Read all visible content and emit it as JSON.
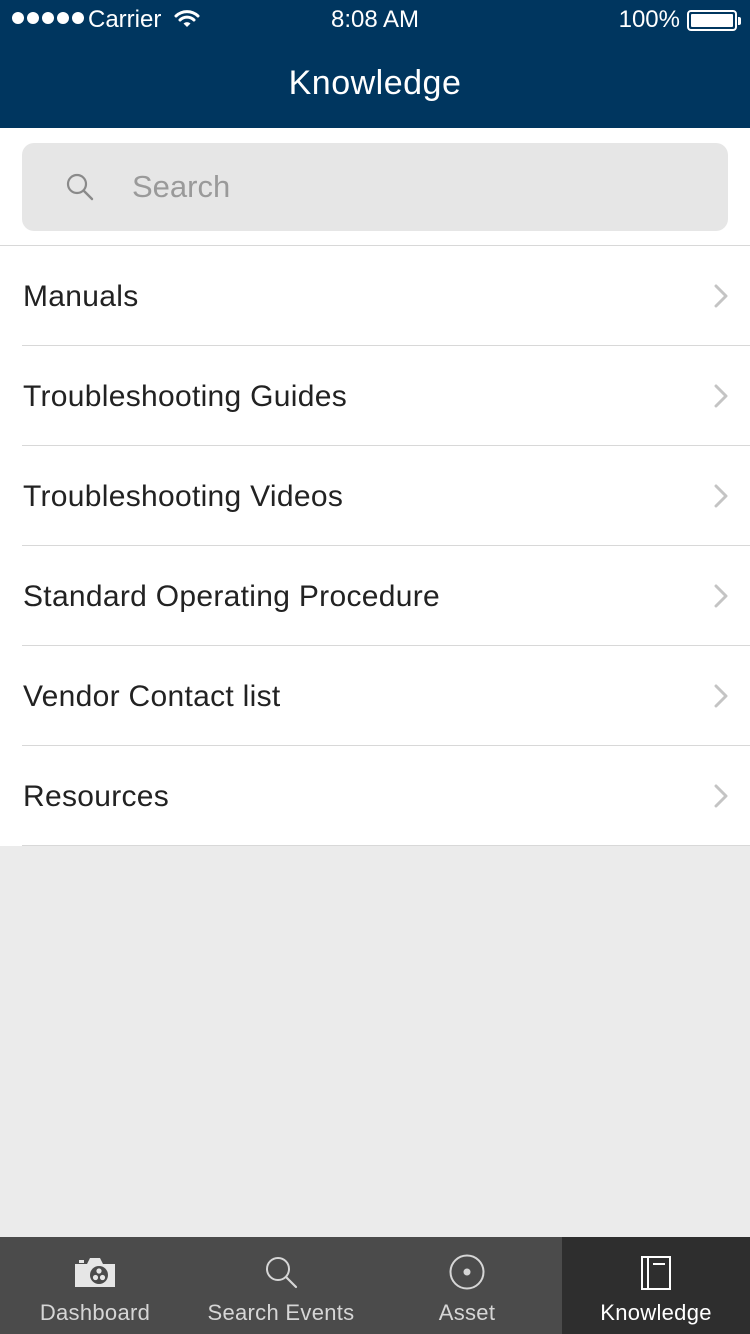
{
  "status_bar": {
    "carrier": "Carrier",
    "time": "8:08 AM",
    "battery": "100%"
  },
  "header": {
    "title": "Knowledge"
  },
  "search": {
    "placeholder": "Search",
    "value": ""
  },
  "list": {
    "items": [
      {
        "label": "Manuals"
      },
      {
        "label": "Troubleshooting Guides"
      },
      {
        "label": "Troubleshooting Videos"
      },
      {
        "label": "Standard Operating Procedure"
      },
      {
        "label": "Vendor Contact list"
      },
      {
        "label": "Resources"
      }
    ]
  },
  "tabbar": {
    "tabs": [
      {
        "label": "Dashboard",
        "icon": "camera-icon"
      },
      {
        "label": "Search Events",
        "icon": "search-icon"
      },
      {
        "label": "Asset",
        "icon": "target-icon"
      },
      {
        "label": "Knowledge",
        "icon": "book-icon",
        "active": true
      }
    ]
  },
  "colors": {
    "header": "#00365f",
    "tabbar": "#4b4b4b",
    "tab_active": "#2e2e2e",
    "background": "#ebebeb"
  }
}
